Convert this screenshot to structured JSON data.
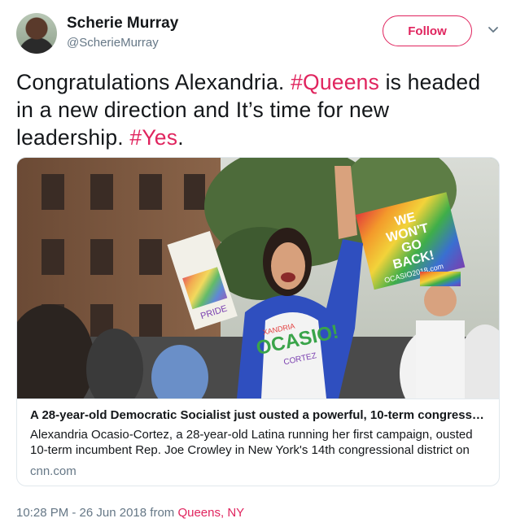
{
  "author": {
    "name": "Scherie Murray",
    "handle": "@ScherieMurray"
  },
  "follow_label": "Follow",
  "tweet": {
    "part1": "Congratulations Alexandria. ",
    "hashtag1": "#Queens",
    "part2": " is headed in a new direction and It’s time for new leadership. ",
    "hashtag2": "#Yes",
    "part3": "."
  },
  "card": {
    "title": "A 28-year-old Democratic Socialist just ousted a powerful, 10-term congress…",
    "description": "Alexandria Ocasio-Cortez, a 28-year-old Latina running her first campaign, ousted 10-term incumbent Rep. Joe Crowley in New York's 14th congressional district on",
    "domain": "cnn.com",
    "image_signs": {
      "shirt": "OCASIO!",
      "shirt_top": "XANDRIA",
      "shirt_bottom": "CORTEZ",
      "rainbow_sign_line1": "WE",
      "rainbow_sign_line2": "WON'T",
      "rainbow_sign_line3": "GO",
      "rainbow_sign_line4": "BACK!",
      "rainbow_sign_url": "OCASIO2018.com",
      "left_sign": "PRIDE"
    }
  },
  "timestamp": {
    "time": "10:28 PM - 26 Jun 2018",
    "from": " from ",
    "location": "Queens, NY"
  },
  "colors": {
    "accent": "#e0245e",
    "secondary_text": "#657786",
    "text": "#14171a",
    "border": "#e1e8ed"
  }
}
